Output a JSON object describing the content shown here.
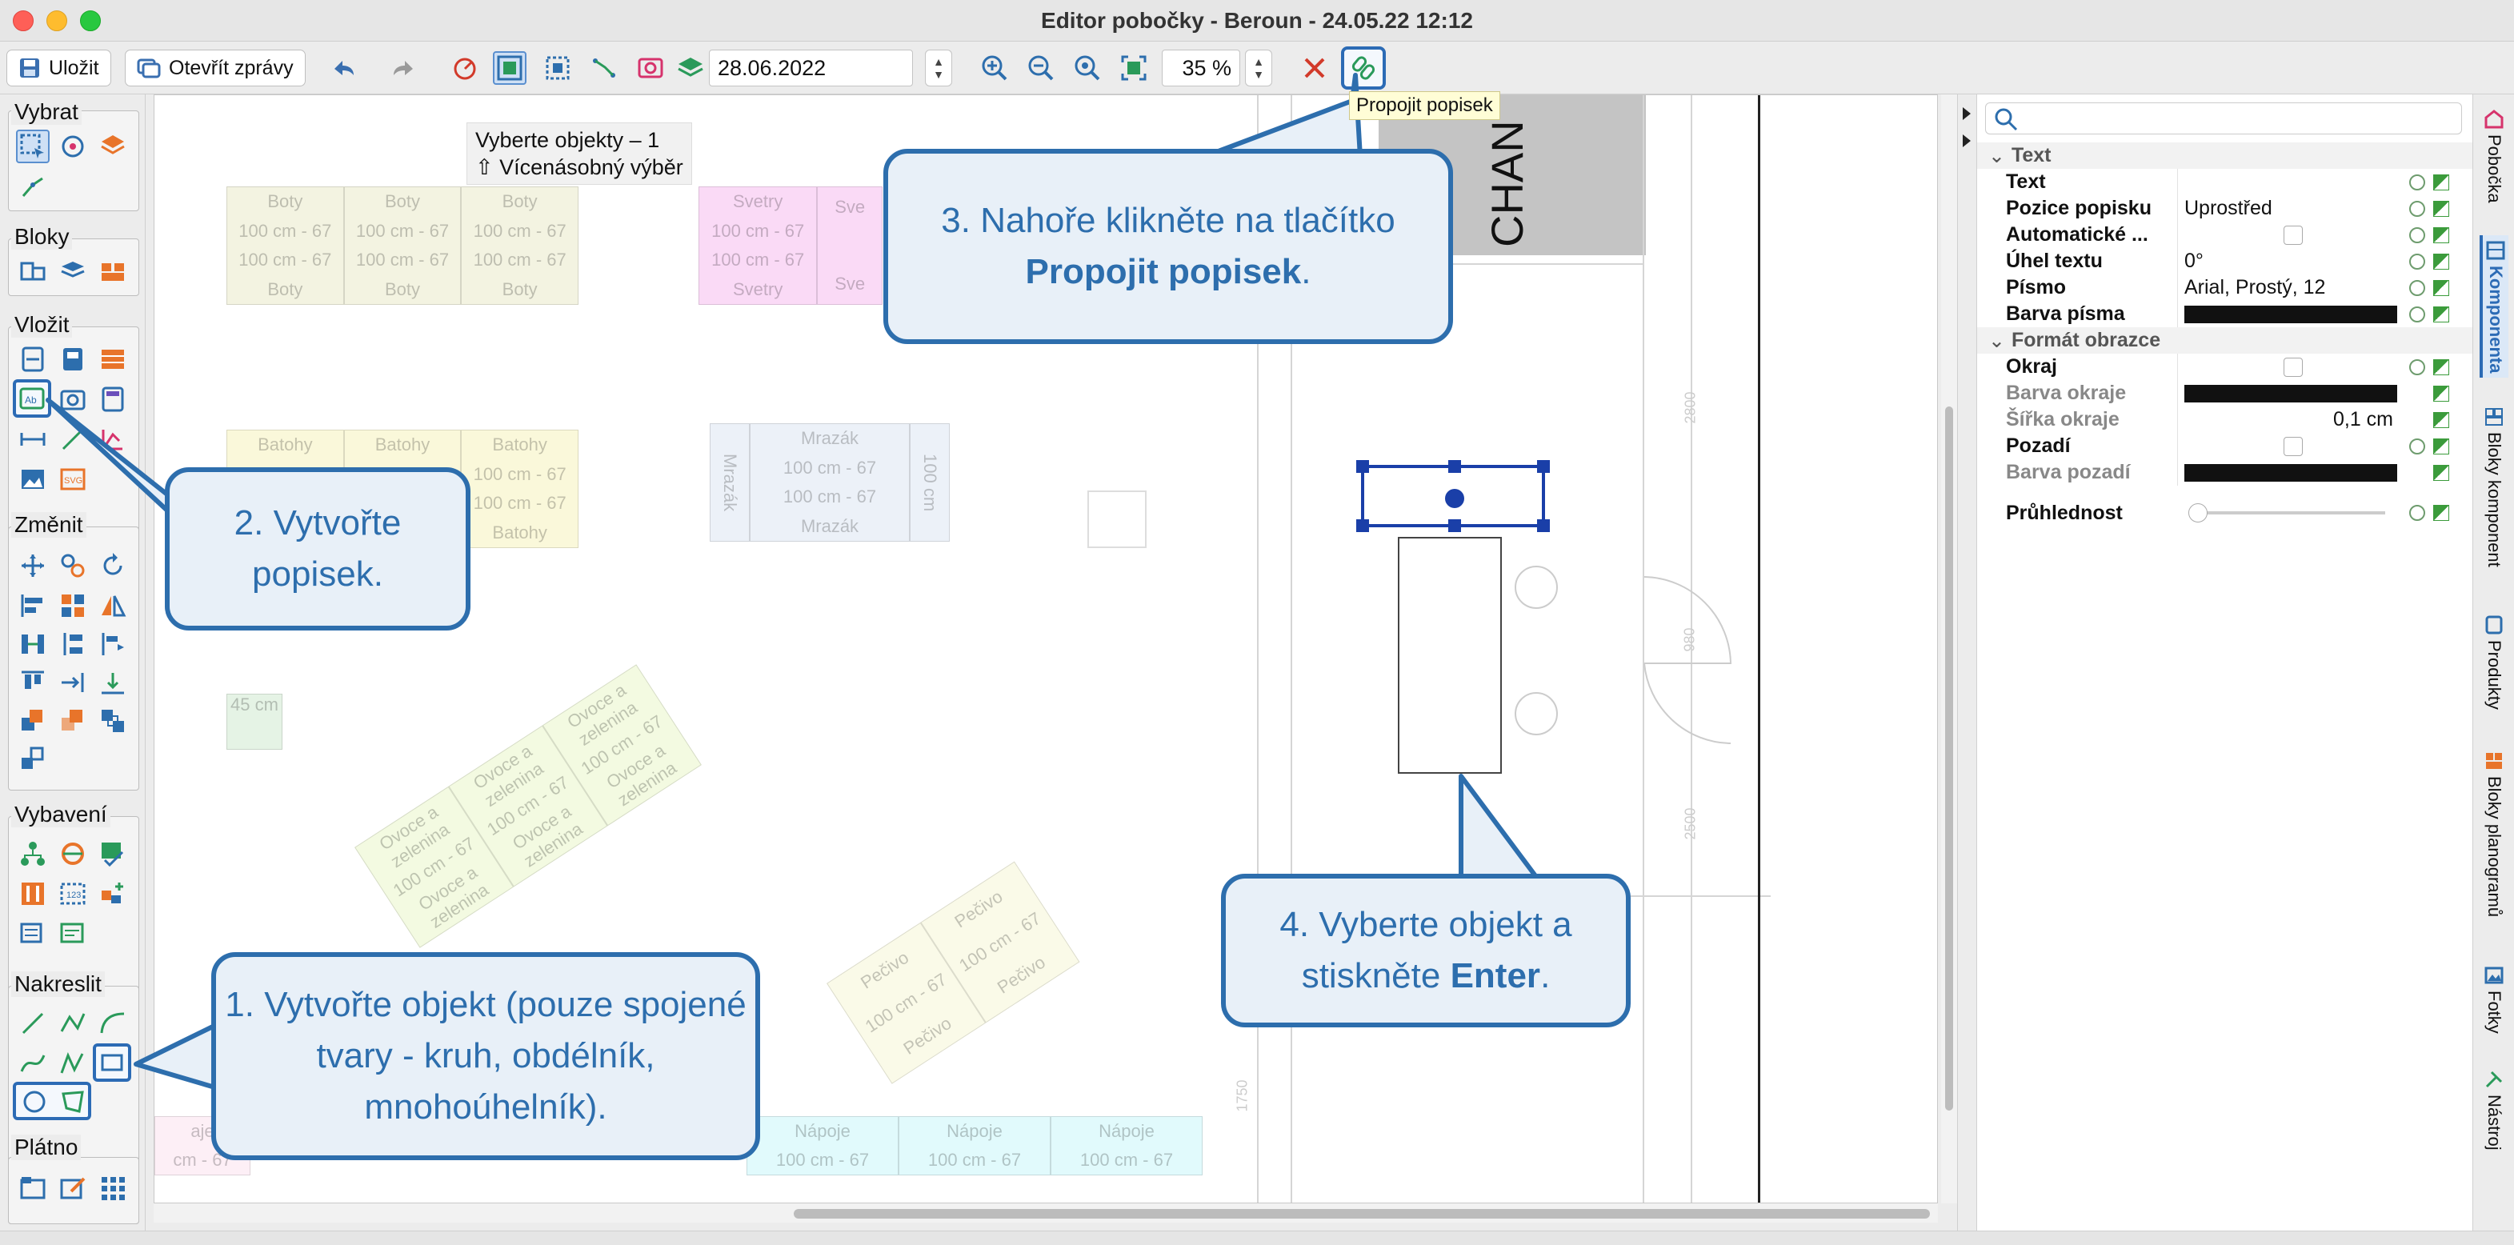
{
  "window": {
    "title": "Editor pobočky - Beroun - 24.05.22 12:12"
  },
  "toolbar": {
    "save_label": "Uložit",
    "open_reports_label": "Otevřít zprávy",
    "date_value": "28.06.2022",
    "zoom_value": "35 %",
    "tooltip": "Propojit popisek"
  },
  "palette": {
    "groups": [
      {
        "title": "Vybrat"
      },
      {
        "title": "Bloky"
      },
      {
        "title": "Vložit"
      },
      {
        "title": "Změnit"
      },
      {
        "title": "Vybavení"
      },
      {
        "title": "Nakreslit"
      },
      {
        "title": "Plátno"
      }
    ]
  },
  "canvas": {
    "selection_info": {
      "line1": "Vyberte objekty – 1",
      "line2": "⇧ Vícenásobný výběr"
    },
    "chan_label": "CHAN",
    "fixtures": {
      "boty": {
        "top": "Boty",
        "mid1": "100 cm - 67",
        "mid2": "100 cm - 67",
        "bottom": "Boty"
      },
      "svetry": {
        "top": "Svetry",
        "mid1": "100 cm - 67",
        "mid2": "100 cm - 67",
        "bottom": "Svetry",
        "partial_top": "Sve",
        "partial_bottom": "Sve"
      },
      "batohy": {
        "top": "Batohy",
        "mid1": "100 cm - 67",
        "mid2": "100 cm - 67",
        "bottom": "Batohy"
      },
      "mrazak": {
        "top": "Mrazák",
        "mid1": "100 cm - 67",
        "mid2": "100 cm - 67",
        "bottom": "Mrazák",
        "side": "Mrazák",
        "side_dim": "100 cm"
      },
      "small": {
        "label": "45 cm"
      },
      "napoje": {
        "top": "Nápoje",
        "mid": "100 cm - 67",
        "partial_top": "aje",
        "partial_mid": "cm - 67"
      },
      "ovoce": {
        "label": "Ovoce a zelenina",
        "mid": "100 cm - 67"
      },
      "pecivo": {
        "label": "Pečivo",
        "mid": "100 cm - 67"
      }
    },
    "dims": [
      "2800",
      "980",
      "2500",
      "1750"
    ]
  },
  "callouts": {
    "c1": {
      "text": "1. Vytvořte objekt (pouze spojené tvary - kruh, obdélník, mnohoúhelník)."
    },
    "c2": {
      "text": "2. Vytvořte popisek."
    },
    "c3": {
      "pre": "3. Nahoře klikněte na tlačítko ",
      "bold": "Propojit popisek",
      "post": "."
    },
    "c4": {
      "pre": "4. Vyberte objekt a stiskněte ",
      "bold": "Enter",
      "post": "."
    }
  },
  "properties": {
    "search_placeholder": "",
    "section_text": "Text",
    "section_image": "Formát obrazce",
    "rows": {
      "text": {
        "label": "Text",
        "value": ""
      },
      "label_pos": {
        "label": "Pozice popisku",
        "value": "Uprostřed"
      },
      "auto": {
        "label": "Automatické ...",
        "value": ""
      },
      "angle": {
        "label": "Úhel textu",
        "value": "0°"
      },
      "font": {
        "label": "Písmo",
        "value": "Arial, Prostý, 12"
      },
      "font_color": {
        "label": "Barva písma",
        "value": ""
      },
      "border": {
        "label": "Okraj",
        "value": ""
      },
      "border_color": {
        "label": "Barva okraje",
        "value": ""
      },
      "border_width": {
        "label": "Šířka okraje",
        "value": "0,1 cm"
      },
      "background": {
        "label": "Pozadí",
        "value": ""
      },
      "background_color": {
        "label": "Barva pozadí",
        "value": ""
      },
      "transparency": {
        "label": "Průhlednost",
        "value": ""
      }
    }
  },
  "side_tabs": [
    {
      "label": "Pobočka",
      "icon": "store-icon"
    },
    {
      "label": "Komponenta",
      "icon": "component-icon",
      "active": true
    },
    {
      "label": "Bloky komponent",
      "icon": "blocks-icon"
    },
    {
      "label": "Produkty",
      "icon": "product-icon"
    },
    {
      "label": "Bloky planogramů",
      "icon": "planogram-icon"
    },
    {
      "label": "Fotky",
      "icon": "photo-icon"
    },
    {
      "label": "Nástroj",
      "icon": "tool-icon"
    }
  ],
  "colors": {
    "callout_blue": "#2d6ead",
    "callout_fill": "#e8f0f8",
    "selection_blue": "#1a3fa8"
  }
}
